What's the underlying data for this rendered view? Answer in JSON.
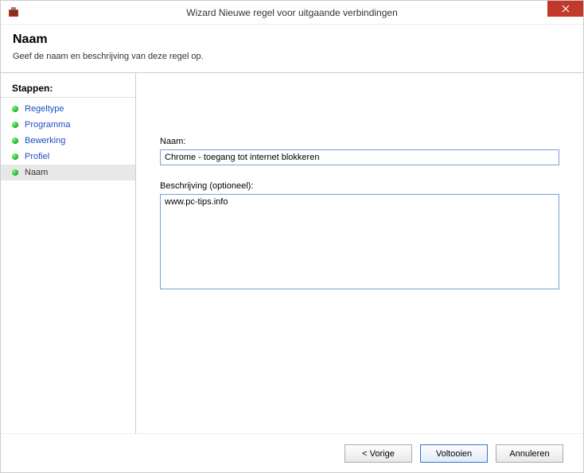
{
  "window": {
    "title": "Wizard Nieuwe regel voor uitgaande verbindingen"
  },
  "header": {
    "title": "Naam",
    "subtitle": "Geef de naam en beschrijving van deze regel op."
  },
  "sidebar": {
    "title": "Stappen:",
    "steps": [
      {
        "label": "Regeltype"
      },
      {
        "label": "Programma"
      },
      {
        "label": "Bewerking"
      },
      {
        "label": "Profiel"
      },
      {
        "label": "Naam"
      }
    ]
  },
  "form": {
    "name_label": "Naam:",
    "name_value": "Chrome - toegang tot internet blokkeren",
    "desc_label": "Beschrijving (optioneel):",
    "desc_value": "www.pc-tips.info"
  },
  "buttons": {
    "back": "< Vorige",
    "finish": "Voltooien",
    "cancel": "Annuleren"
  }
}
